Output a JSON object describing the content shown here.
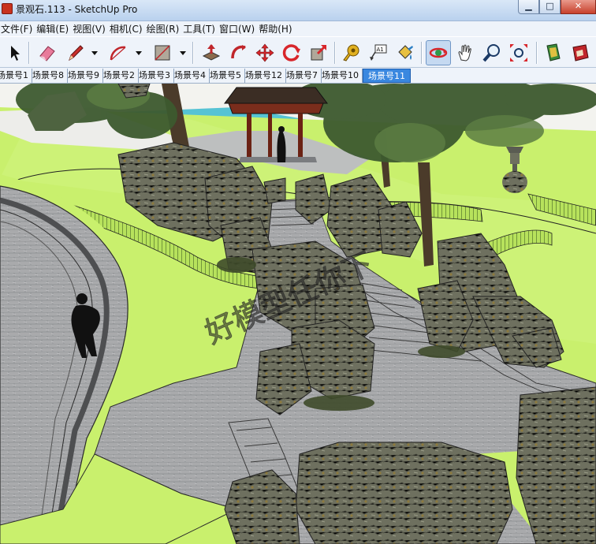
{
  "window": {
    "title": "景观石.113 - SketchUp Pro"
  },
  "menu": [
    "文件(F)",
    "编辑(E)",
    "视图(V)",
    "相机(C)",
    "绘图(R)",
    "工具(T)",
    "窗口(W)",
    "帮助(H)"
  ],
  "toolbar": {
    "tools": [
      "select-icon",
      "eraser-icon",
      "pencil-icon",
      "arc-icon",
      "rectangle-icon",
      "push-pull-icon",
      "follow-me-icon",
      "move-icon",
      "rotate-icon",
      "scale-icon",
      "tape-measure-icon",
      "text-label-icon",
      "paint-bucket-icon",
      "orbit-icon",
      "pan-icon",
      "zoom-icon",
      "zoom-extents-icon",
      "components-icon",
      "warehouse-icon"
    ],
    "active_tool": "orbit-icon"
  },
  "scene_tabs": [
    "场景号1",
    "场景号8",
    "场景号9",
    "场景号2",
    "场景号3",
    "场景号4",
    "场景号5",
    "场景号12",
    "场景号7",
    "场景号10",
    "场景号11"
  ],
  "active_scene": "场景号11",
  "viewport": {
    "watermark": "好模型任你下"
  },
  "colors": {
    "lawn": "#c8f16a",
    "path": "#a9aaac",
    "rock": "#6f705e",
    "water": "#4fc3d6",
    "active_tab": "#3a88e0"
  }
}
